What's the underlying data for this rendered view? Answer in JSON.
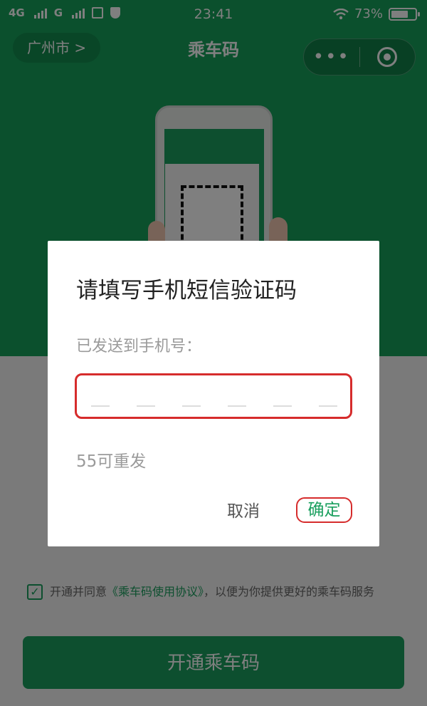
{
  "status_bar": {
    "network_1": "4G",
    "network_2": "G",
    "time": "23:41",
    "battery": "73%",
    "battery_level": 0.73
  },
  "navbar": {
    "city": "广州市 >",
    "title": "乘车码",
    "more": "•••"
  },
  "agreement": {
    "prefix": "开通并同意",
    "link": "《乘车码使用协议》",
    "suffix": "，以便为你提供更好的乘车码服务"
  },
  "open_button": "开通乘车码",
  "dialog": {
    "title": "请填写手机短信验证码",
    "subtitle": "已发送到手机号：",
    "code_value": "",
    "resend": "55可重发",
    "cancel": "取消",
    "confirm": "确定"
  }
}
